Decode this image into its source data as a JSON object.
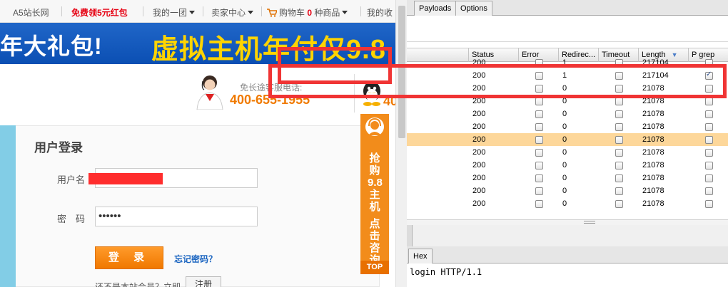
{
  "topnav": {
    "site_name": "A5站长网",
    "promo": "免费领5元红包",
    "my_group": "我的一团",
    "seller_center": "卖家中心",
    "cart_prefix": "购物车",
    "cart_count": "0",
    "cart_suffix": "种商品",
    "favorites": "我的收"
  },
  "banner": {
    "left_text": "年大礼包!",
    "right_text": "虚拟主机年付仅9.8"
  },
  "hotline": {
    "label": "免长途客服电话:",
    "number": "400-655-1955",
    "second_number": "40"
  },
  "login": {
    "title": "用户登录",
    "username_label": "用户名",
    "username_value": "",
    "password_label": "密　码",
    "password_value": "••••••",
    "submit_label": "登 录",
    "forgot_link": "忘记密码？",
    "register_prompt": "还不是本站会员？立即",
    "register_button": "注册"
  },
  "float_ad": {
    "line1": "抢购9.8主机",
    "line2": "点击咨询",
    "top_button": "TOP"
  },
  "intruder": {
    "tabs": [
      "Payloads",
      "Options"
    ],
    "columns": [
      "Status",
      "Error",
      "Redirec...",
      "Timeout",
      "Length",
      "P grep"
    ],
    "rows": [
      {
        "status": "200",
        "error": false,
        "redirects": "1",
        "timeout": false,
        "length": "217104",
        "grep": false
      },
      {
        "status": "200",
        "error": false,
        "redirects": "1",
        "timeout": false,
        "length": "217104",
        "grep": true
      },
      {
        "status": "200",
        "error": false,
        "redirects": "0",
        "timeout": false,
        "length": "21078",
        "grep": false
      },
      {
        "status": "200",
        "error": false,
        "redirects": "0",
        "timeout": false,
        "length": "21078",
        "grep": false
      },
      {
        "status": "200",
        "error": false,
        "redirects": "0",
        "timeout": false,
        "length": "21078",
        "grep": false
      },
      {
        "status": "200",
        "error": false,
        "redirects": "0",
        "timeout": false,
        "length": "21078",
        "grep": false
      },
      {
        "status": "200",
        "error": false,
        "redirects": "0",
        "timeout": false,
        "length": "21078",
        "grep": false
      },
      {
        "status": "200",
        "error": false,
        "redirects": "0",
        "timeout": false,
        "length": "21078",
        "grep": false
      },
      {
        "status": "200",
        "error": false,
        "redirects": "0",
        "timeout": false,
        "length": "21078",
        "grep": false
      },
      {
        "status": "200",
        "error": false,
        "redirects": "0",
        "timeout": false,
        "length": "21078",
        "grep": false
      },
      {
        "status": "200",
        "error": false,
        "redirects": "0",
        "timeout": false,
        "length": "21078",
        "grep": false
      },
      {
        "status": "200",
        "error": false,
        "redirects": "0",
        "timeout": false,
        "length": "21078",
        "grep": false
      }
    ],
    "selected_row": 6,
    "request_tab": "Hex",
    "request_line": "login HTTP/1.1"
  },
  "colors": {
    "brand_orange": "#f28c1b",
    "banner_blue": "#0b4fb3",
    "annotation_red": "#f03434",
    "selection": "#fdd79a"
  }
}
